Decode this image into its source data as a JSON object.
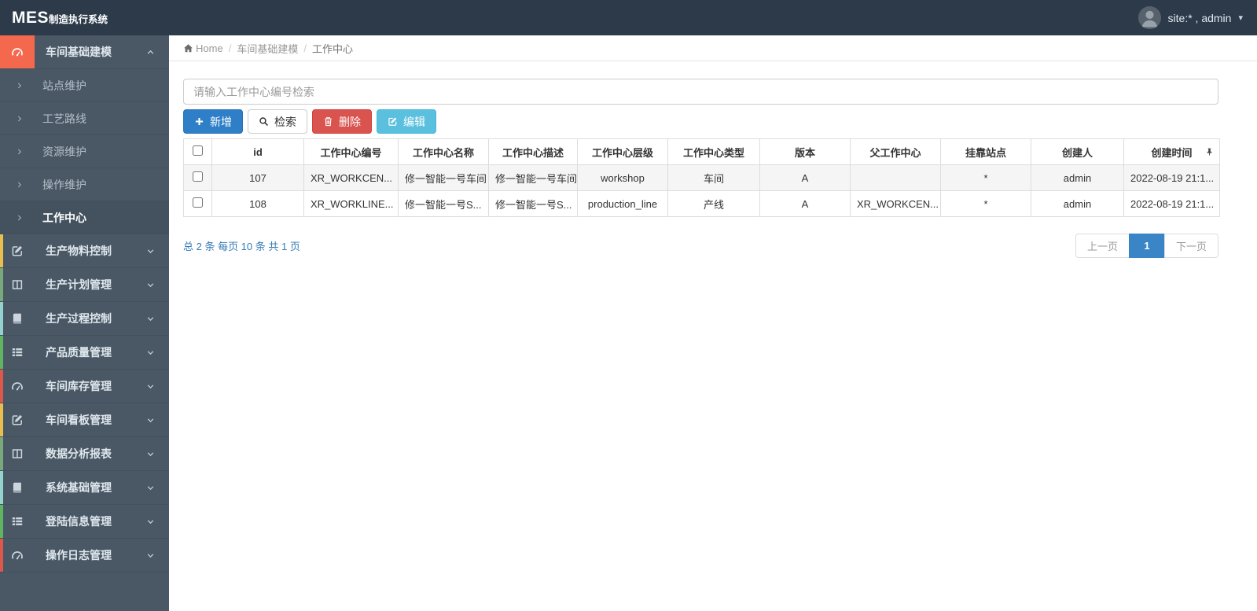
{
  "navbar": {
    "brand_main": "MES",
    "brand_sub": "制造执行系统",
    "user_label": "site:* , admin"
  },
  "breadcrumb": {
    "home": "Home",
    "items": [
      "车间基础建模",
      "工作中心"
    ]
  },
  "sidebar": {
    "active_parent": {
      "label": "车间基础建模",
      "icon": "dashboard-icon"
    },
    "submenu": [
      {
        "label": "站点维护",
        "active": false
      },
      {
        "label": "工艺路线",
        "active": false
      },
      {
        "label": "资源维护",
        "active": false
      },
      {
        "label": "操作维护",
        "active": false
      },
      {
        "label": "工作中心",
        "active": true
      }
    ],
    "items": [
      {
        "label": "生产物料控制",
        "icon": "edit-icon",
        "strip": "#e8bf4e"
      },
      {
        "label": "生产计划管理",
        "icon": "columns-icon",
        "strip": "#79a87b"
      },
      {
        "label": "生产过程控制",
        "icon": "book-icon",
        "strip": "#93d2cf"
      },
      {
        "label": "产品质量管理",
        "icon": "list-icon",
        "strip": "#5fb560"
      },
      {
        "label": "车间库存管理",
        "icon": "dashboard-icon",
        "strip": "#dc584b"
      },
      {
        "label": "车间看板管理",
        "icon": "edit-icon",
        "strip": "#e8bf4e"
      },
      {
        "label": "数据分析报表",
        "icon": "columns-icon",
        "strip": "#79a87b"
      },
      {
        "label": "系统基础管理",
        "icon": "book-icon",
        "strip": "#93d2cf"
      },
      {
        "label": "登陆信息管理",
        "icon": "list-icon",
        "strip": "#5fb560"
      },
      {
        "label": "操作日志管理",
        "icon": "dashboard-icon",
        "strip": "#dc584b"
      }
    ]
  },
  "toolbar": {
    "search_placeholder": "请输入工作中心编号检索",
    "search_value": "",
    "buttons": [
      {
        "name": "add-button",
        "label": "新增",
        "icon": "plus-icon",
        "style": "primary"
      },
      {
        "name": "search-button",
        "label": "检索",
        "icon": "search-icon",
        "style": "default"
      },
      {
        "name": "delete-button",
        "label": "删除",
        "icon": "trash-icon",
        "style": "danger"
      },
      {
        "name": "edit-button",
        "label": "编辑",
        "icon": "pencil-square-icon",
        "style": "info"
      }
    ]
  },
  "table": {
    "columns": [
      "id",
      "工作中心编号",
      "工作中心名称",
      "工作中心描述",
      "工作中心层级",
      "工作中心类型",
      "版本",
      "父工作中心",
      "挂靠站点",
      "创建人",
      "创建时间"
    ],
    "aligns": [
      "center",
      "left",
      "left",
      "left",
      "center",
      "center",
      "center",
      "left",
      "center",
      "center",
      "left"
    ],
    "rows": [
      {
        "checked": false,
        "cells": [
          "107",
          "XR_WORKCEN...",
          "修一智能一号车间",
          "修一智能一号车间",
          "workshop",
          "车间",
          "A",
          "",
          "*",
          "admin",
          "2022-08-19 21:1..."
        ]
      },
      {
        "checked": false,
        "cells": [
          "108",
          "XR_WORKLINE...",
          "修一智能一号S...",
          "修一智能一号S...",
          "production_line",
          "产线",
          "A",
          "XR_WORKCEN...",
          "*",
          "admin",
          "2022-08-19 21:1..."
        ]
      }
    ]
  },
  "pagination": {
    "summary": "总 2 条 每页 10 条 共 1 页",
    "prev": "上一页",
    "page": "1",
    "next": "下一页"
  },
  "colors": {
    "navbar_bg": "#2c3a49",
    "sidebar_bg": "#4a5865",
    "sidebar_active_accent": "#f4684e",
    "primary_button": "#2e7fc7",
    "danger_button": "#d9534f",
    "info_button": "#5bc0de",
    "active_page": "#3a85c6",
    "link_text": "#337ab7"
  }
}
